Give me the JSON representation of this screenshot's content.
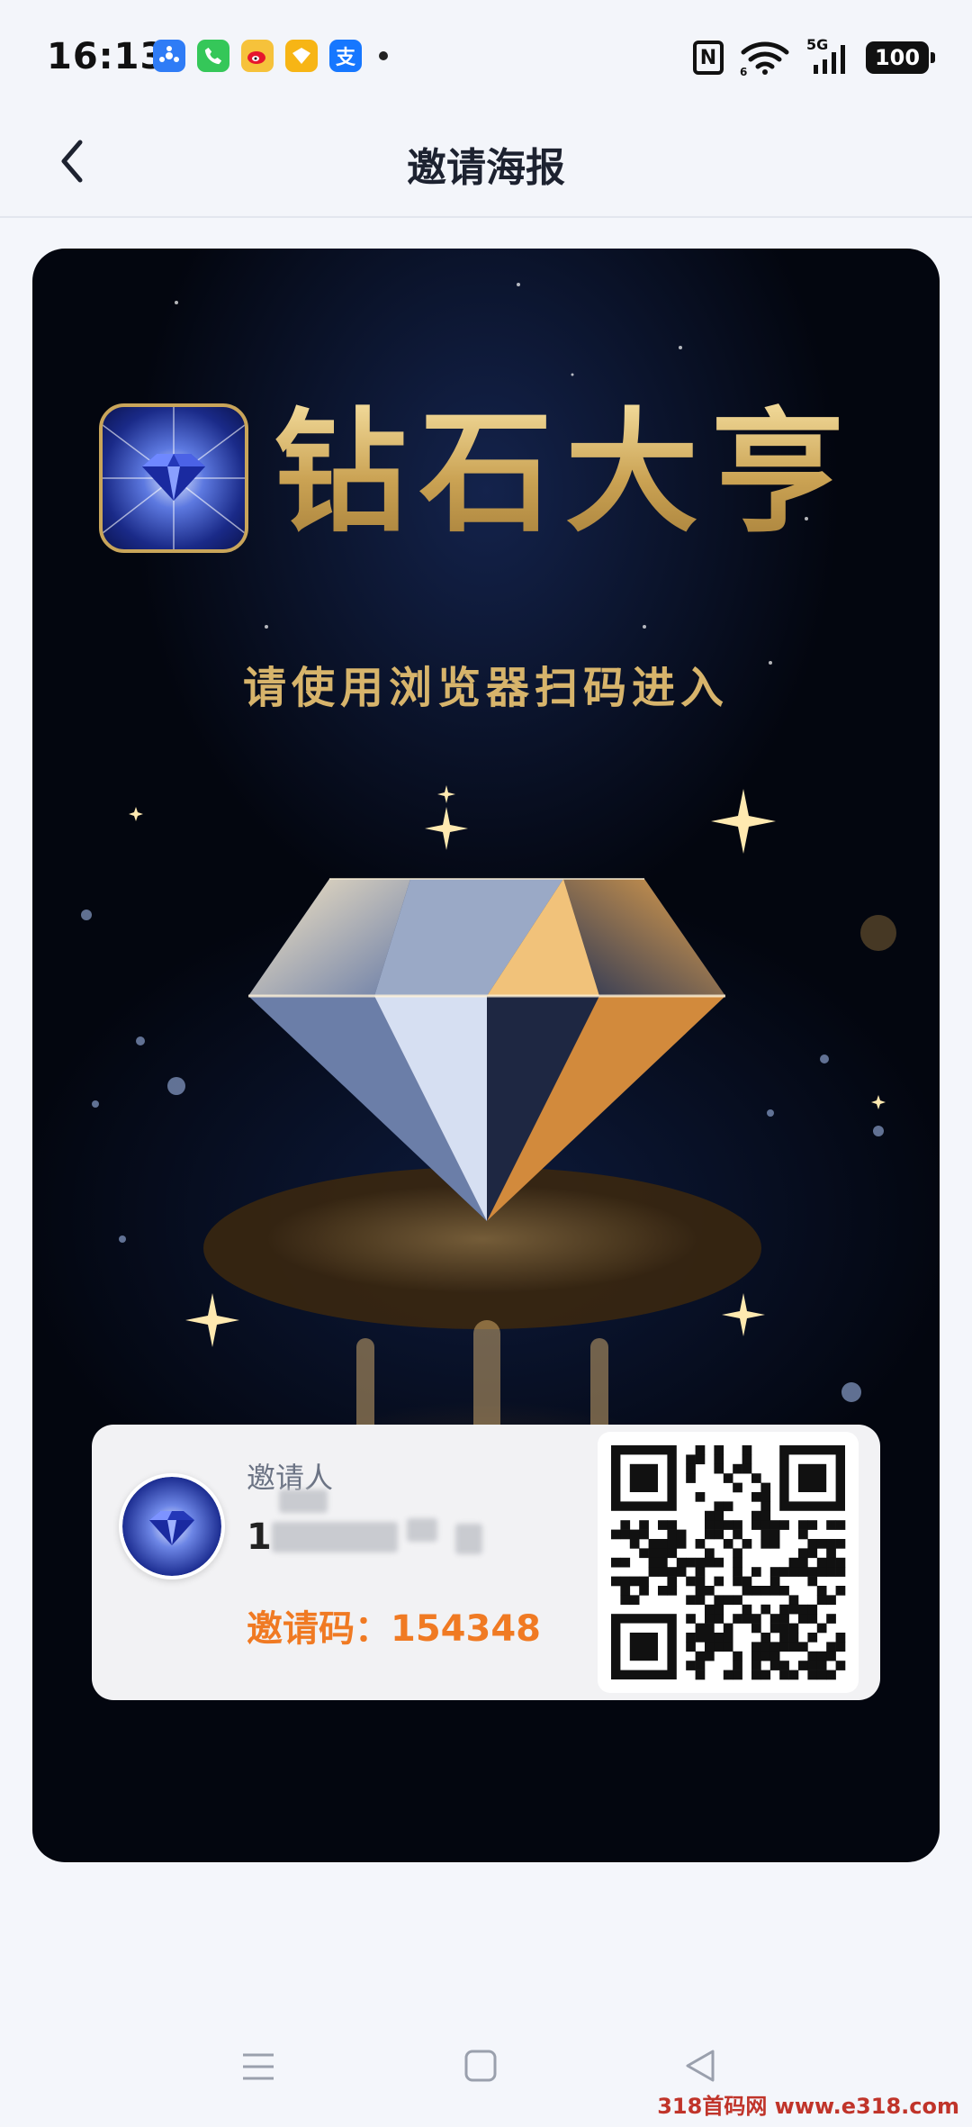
{
  "status_bar": {
    "time": "16:13",
    "notification_icons": [
      "app-icon",
      "phone-icon",
      "weibo-icon",
      "wallet-icon",
      "alipay-icon"
    ],
    "alipay_glyph": "支",
    "network": "5G",
    "battery": "100"
  },
  "header": {
    "title": "邀请海报"
  },
  "poster": {
    "app_name": "钻石大亨",
    "tagline": "请使用浏览器扫码进入",
    "accent_color": "#d7b46b"
  },
  "invite_card": {
    "inviter_label": "邀请人",
    "inviter_id_visible": "1",
    "invite_code_label": "邀请码：154348",
    "code_color": "#f07a23"
  },
  "footer": {
    "watermark": "318首码网 www.e318.com"
  }
}
